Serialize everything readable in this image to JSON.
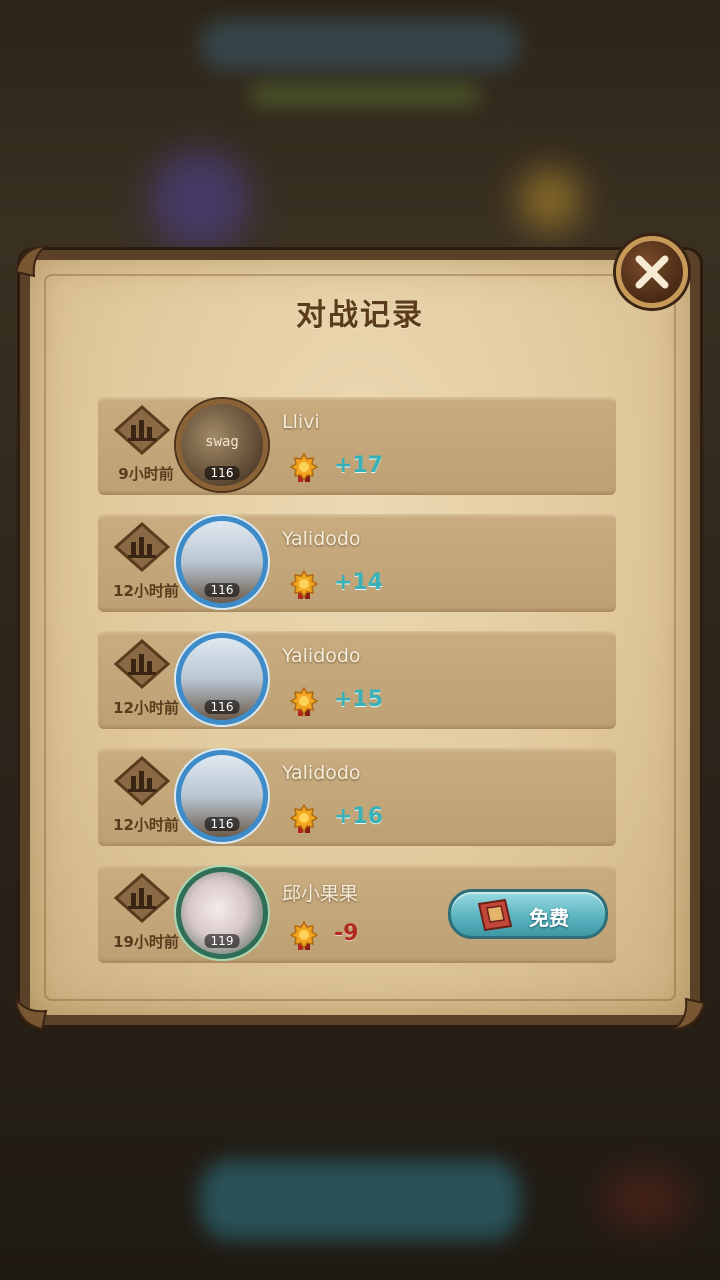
{
  "dialog": {
    "title": "对战记录"
  },
  "records": [
    {
      "time": "9小时前",
      "name": "Llivi",
      "level": "116",
      "avatar_label": "swag",
      "score": "+17",
      "frame": "bronze",
      "result": "positive"
    },
    {
      "time": "12小时前",
      "name": "Yalidodo",
      "level": "116",
      "avatar_label": "",
      "score": "+14",
      "frame": "blue",
      "result": "positive"
    },
    {
      "time": "12小时前",
      "name": "Yalidodo",
      "level": "116",
      "avatar_label": "",
      "score": "+15",
      "frame": "blue",
      "result": "positive"
    },
    {
      "time": "12小时前",
      "name": "Yalidodo",
      "level": "116",
      "avatar_label": "",
      "score": "+16",
      "frame": "blue",
      "result": "positive"
    },
    {
      "time": "19小时前",
      "name": "邱小果果",
      "level": "119",
      "avatar_label": "",
      "score": "-9",
      "frame": "green",
      "result": "negative",
      "action_label": "免费"
    }
  ],
  "colors": {
    "positive_score": "#3ab0b7",
    "negative_score": "#b02a1f",
    "title": "#5a3b1c"
  },
  "icons": {
    "close": "close-icon",
    "replay": "replay-chart-icon",
    "medal": "medal-icon",
    "ticket": "ticket-icon"
  }
}
